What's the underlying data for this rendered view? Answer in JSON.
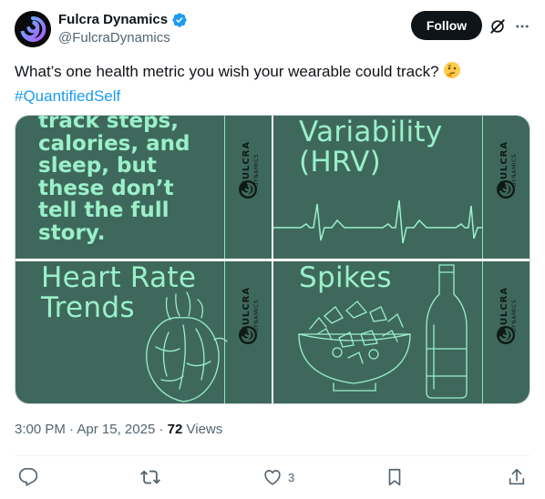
{
  "author": {
    "display_name": "Fulcra Dynamics",
    "handle": "@FulcraDynamics",
    "verified": true
  },
  "buttons": {
    "follow_label": "Follow",
    "grok_icon": "grok-slash-icon",
    "more_icon": "more-dots-icon"
  },
  "tweet": {
    "text": "What’s one health metric you wish your wearable could track?",
    "emoji": "thinking-face-emoji",
    "hashtag": "#QuantifiedSelf"
  },
  "media": {
    "tiles": [
      {
        "text": "track steps,\ncalories, and\nsleep, but\nthese don’t\ntell the full\nstory."
      },
      {
        "text": "Variability\n(HRV)"
      },
      {
        "text": "Heart Rate\nTrends"
      },
      {
        "text": "Spikes"
      }
    ],
    "brand_text": "FULCRA",
    "brand_subtext": "DYNAMICS",
    "colors": {
      "tile_bg": "#3f685c",
      "tile_text": "#9af0c9"
    }
  },
  "meta": {
    "time": "3:00 PM",
    "date": "Apr 15, 2025",
    "views_count": "72",
    "views_label": "Views",
    "separator": "·"
  },
  "actions": {
    "reply_icon": "reply-icon",
    "retweet_icon": "retweet-icon",
    "like_icon": "like-heart-icon",
    "like_count": "3",
    "bookmark_icon": "bookmark-icon",
    "share_icon": "share-icon"
  },
  "colors": {
    "accent": "#1d9bf0",
    "text_primary": "#0f1419",
    "text_secondary": "#536471"
  }
}
